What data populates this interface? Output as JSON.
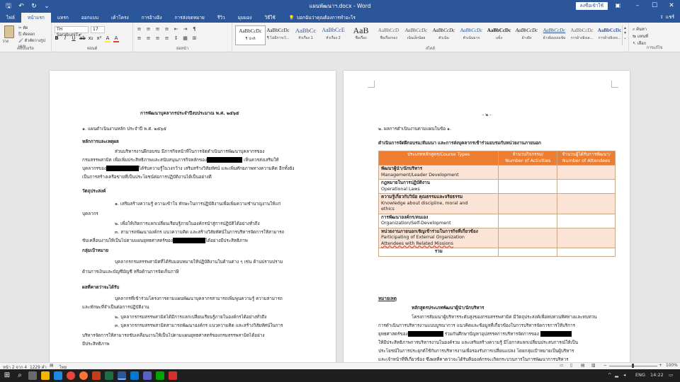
{
  "window": {
    "title": "แผนพัฒนาฯ.docx - Word",
    "signin_label": "ลงชื่อเข้าใช้",
    "minimize": "–",
    "maximize": "☐",
    "close": "✕"
  },
  "qat": {
    "save": "🖫",
    "undo": "↶",
    "redo": "↻",
    "more": "⌄"
  },
  "tabs": [
    "ไฟล์",
    "หน้าแรก",
    "แทรก",
    "ออกแบบ",
    "เค้าโครง",
    "การอ้างอิง",
    "การส่งจดหมาย",
    "รีวิว",
    "มุมมอง",
    "วิธีใช้"
  ],
  "tellme": "บอกฉันว่าคุณต้องการทำอะไร",
  "share_label": "แชร์",
  "ribbon": {
    "paste": "วาง",
    "cut": "ตัด",
    "copy": "คัดลอก",
    "format_painter": "ตัวคัดวางรูปแบบ",
    "group_clipboard": "คลิปบอร์ด",
    "font_name": "TH SarabunIT๙",
    "font_size": "17",
    "group_font": "ฟอนต์",
    "group_paragraph": "ย่อหน้า",
    "group_styles": "สไตล์",
    "group_editing": "การแก้ไข",
    "find": "ค้นหา",
    "replace": "แทนที่",
    "select": "เลือก",
    "fmt_buttons": [
      "B",
      "I",
      "U",
      "ab",
      "x₂",
      "x²",
      "A",
      "A"
    ],
    "para_buttons": [
      "≡",
      "≡",
      "≡",
      "≡",
      "⇤",
      "⇥",
      "¶"
    ],
    "para_buttons2": [
      "≡",
      "≡",
      "≡",
      "≡",
      "↕",
      "▦",
      "⊞"
    ]
  },
  "styles": [
    {
      "sample": "AaBbCcDc",
      "name": "¶ ปกติ"
    },
    {
      "sample": "AaBbCcDc",
      "name": "¶ ไม่มีการเว้..."
    },
    {
      "sample": "AaBbCc",
      "name": "หัวเรื่อง 1"
    },
    {
      "sample": "AaBbCcE",
      "name": "หัวเรื่อง 2"
    },
    {
      "sample": "AaB",
      "name": "ชื่อเรื่อง"
    },
    {
      "sample": "AaBbCcD",
      "name": "ชื่อเรื่องรอง"
    },
    {
      "sample": "AaBbCcDc",
      "name": "เน้นเล็กน้อย"
    },
    {
      "sample": "AaBbCcDc",
      "name": "ตัวเน้น"
    },
    {
      "sample": "AaBbCcDc",
      "name": "ตัวเน้นมาก"
    },
    {
      "sample": "AaBbCcDc",
      "name": "แข็ง"
    },
    {
      "sample": "AaBbCcDc",
      "name": "อ้างอิง"
    },
    {
      "sample": "AaBbCcDc",
      "name": "อ้างอิงแบบเข้ม"
    },
    {
      "sample": "AaBbCcDc",
      "name": "การอ้างอิงเล..."
    },
    {
      "sample": "AaBbCcDc",
      "name": "การอ้างอิงเข..."
    }
  ],
  "page1": {
    "title": "การพัฒนาบุคลากรประจำปีงบประมาณ พ.ศ. ๒๕๖๕",
    "l1": "๑. แผนดำเนินงานหลัก ประจำปี พ.ศ. ๒๕๖๕",
    "h_principle": "หลักการและเหตุผล",
    "p1a": "ส่วนบริหารงานฝึกอบรม มีภารกิจหน้าที่ในการจัดดำเนินการพัฒนาบุคลากรของ",
    "p1b_pre": "กรมสรรพสามิต เพื่อเพิ่มประสิทธิภาพและสนับสนุนภารกิจหลักของ",
    "p1b_post": " เห็นควรส่งเสริมให้",
    "p1c_pre": "บุคลากรของ",
    "p1c_post": "ได้รับความรู้ในวงกว้าง เสริมสร้างวิสัยทัศน์ และเพิ่มศักยภาพทางความคิด อีกทั้งยัง",
    "p1d": "เป็นการสร้างเครือข่ายที่เป็นประโยชน์ต่อการปฏิบัติงานได้เป็นอย่างดี",
    "h_objective": "วัตถุประสงค์",
    "o1a": "๑. เสริมสร้างความรู้ ความเข้าใจ ทักษะในการปฏิบัติงานเพื่อเพิ่มความชำนาญงานให้แก่",
    "o1b": "บุคลากร",
    "o2": "๒. เพื่อให้เกิดการแลกเปลี่ยนเรียนรู้ภายในองค์กรนำสู่การปฏิบัติได้อย่างทั่วถึง",
    "o3a": "๓. สามารถพัฒนาองค์กร แนวความคิด และสร้างวิสัยทัศน์ในการบริหารจัดการให้สามารถ",
    "o3b_pre": "ขับเคลื่อนงานให้เป็นไปตามแผนยุทธศาสตร์ของ",
    "o3b_post": "ได้อย่างมีประสิทธิภาพ",
    "h_target": "กลุ่มเป้าหมาย",
    "t1": "บุคลากรกรมสรรพสามิตที่ได้รับมอบหมายให้ปฏิบัติงานในด้านต่าง ๆ เช่น ด้านปราบปราม",
    "t2": "ด้านการเงินและบัญชีบัญชี หรือด้านการจัดเก็บภาษี",
    "h_expected": "ผลที่คาดว่าจะได้รับ",
    "e1a": "บุคลากรที่เข้าร่วมโครงการตามแผนพัฒนาบุคลากรสามารถเพิ่มพูนความรู้ ความสามารถ",
    "e1b": "และทักษะที่จำเป็นต่อการปฏิบัติงาน",
    "e2": "๒. บุคลากรกรมสรรพสามิตได้มีการแลกเปลี่ยนเรียนรู้ภายในองค์กรได้อย่างทั่วถึง",
    "e3a": "๓. บุคลากรกรมสรรพสามิตสามารถพัฒนาองค์กร แนวความคิด และสร้างวิสัยทัศน์ในการ",
    "e3b": "บริหารจัดการให้สามารถขับเคลื่อนงานให้เป็นไปตามแผนยุทธศาสตร์ของกรมสรรพสามิตได้อย่าง",
    "e3c": "มีประสิทธิภาพ"
  },
  "page2": {
    "page_no": "- ๒ -",
    "l1": "๒. ผลการดำเนินงานตามแผนในข้อ ๑.",
    "table_title": "ดำเนินการจัดฝึกอบรม/สัมมนา และการส่งบุคลากรเข้าร่วมอบรมกับหน่วยงานภายนอก",
    "head": [
      "ประเภทหลักสูตร/Course Types",
      "จำนวนกิจกรรม/",
      "Number of Activities",
      "จำนวนผู้ได้รับการพัฒนา/",
      "Number of Attendees"
    ],
    "rows": [
      {
        "th": "พัฒนาผู้นำ/นักบริหาร",
        "en": "Management/Leader Development"
      },
      {
        "th": "กฎหมายในการปฏิบัติงาน",
        "en": "Operational Laws"
      },
      {
        "th": "ความรู้เกี่ยวกับวินัย คุณธรรมและจริยธรรม",
        "en": "Knowledge about discipline, moral and",
        "en2": "ethics"
      },
      {
        "th": "การพัฒนาองค์กร/ตนเอง",
        "en": "Organization/Self-Development"
      },
      {
        "th": "หน่วยงานภายนอกเชิญเข้าร่วมในการกิจที่เกี่ยวข้อง",
        "en": "Participating of External Organization",
        "en2": "Attendees with Related Missions"
      }
    ],
    "total": "รวม",
    "h_note": "หมายเหตุ",
    "sub": "หลักสูตรประเภทพัฒนาผู้นำ/นักบริหาร",
    "n1": "โครงการสัมมนาผู้บริหารระดับสูงของกรมสรรพสามิต มีวัตถุประสงค์เพื่อทบทวนทิศทางและทบทวน",
    "n2": "การดำเนินการบริหารงานแบบบูรณาการ แนวคิดและข้อมูลที่เกี่ยวข้องในการบริหารจัดการการให้บริการ",
    "n3_pre": "ยุทธศาสตร์ของ",
    "n3_post": " ร่วมกันศึกษาปัญหาอุปสรรคการบริหารจัดการของ",
    "n4": "ให้มีประสิทธิภาพการบริหารงานในองค์รวม และเสริมสร้างความรู้ มีโอกาสแลกเปลี่ยนประสบการณ์ให้เป็น",
    "n5": "ประโยชน์ในการประยุกต์ใช้กับการบริหารงานเพื่อรองรับการเปลี่ยนแปลง โดยกลุ่มเป้าหมายเป็นผู้บริหาร",
    "n6": "และเจ้าหน้าที่ที่เกี่ยวข้อง ซึ่งผลที่คาดว่าจะได้รับคือองค์กรจะเกิดกระบวนการในการพัฒนาการบริหาร"
  },
  "status": {
    "page": "หน้า 2 จาก 4",
    "words": "1229 คำ",
    "lang": "ไทย",
    "zoom": "100%",
    "zoom_minus": "−",
    "zoom_plus": "+"
  },
  "taskbar": {
    "lang": "ENG",
    "time": "14:22",
    "start": "⊞",
    "search": "⌕"
  },
  "colors": {
    "word_blue": "#2b579a",
    "table_header": "#ed7d31",
    "table_shade": "#fbe4d5"
  }
}
